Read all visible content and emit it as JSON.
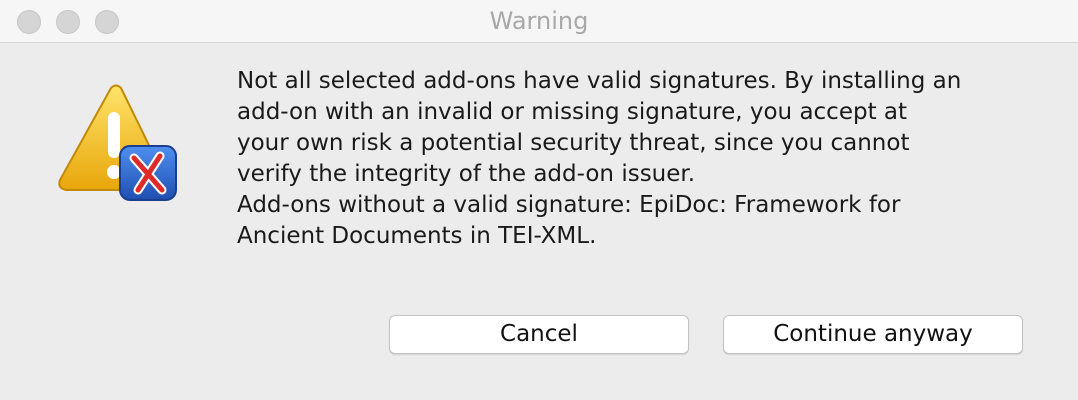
{
  "window": {
    "title": "Warning"
  },
  "icons": {
    "warning": "warning-triangle-icon",
    "app_badge": "oxygen-x-icon"
  },
  "message": {
    "line1": "Not all selected add-ons have valid signatures. By installing an\nadd-on with an invalid or missing signature, you accept at\nyour own risk a potential security threat, since you cannot\nverify the integrity of the add-on issuer.",
    "line2": "Add-ons without a valid signature: EpiDoc: Framework for\nAncient Documents in TEI-XML."
  },
  "buttons": {
    "cancel_label": "Cancel",
    "continue_label": "Continue anyway"
  },
  "colors": {
    "warning_yellow": "#f2c21b",
    "badge_blue": "#2f6fd0",
    "badge_red": "#e02a2a"
  }
}
